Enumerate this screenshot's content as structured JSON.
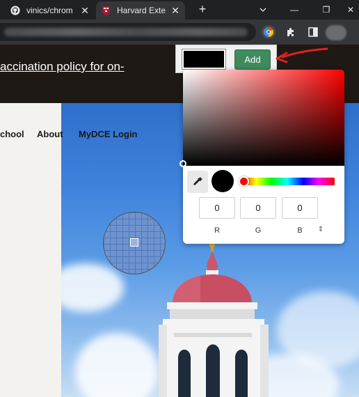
{
  "browser": {
    "tabs": [
      {
        "title": "vinics/chrom",
        "icon": "github-icon"
      },
      {
        "title": "Harvard Exte",
        "icon": "harvard-shield-icon"
      }
    ],
    "new_tab_label": "+",
    "window_controls": {
      "minimize": "—",
      "restore": "❐",
      "close": "✕"
    },
    "toolbar_icons": [
      "color-picker-extension-icon",
      "extensions-puzzle-icon",
      "side-panel-icon",
      "profile-avatar"
    ]
  },
  "page": {
    "announcement": "accination policy for on-",
    "nav": [
      {
        "label": "chool"
      },
      {
        "label": "About"
      },
      {
        "label": "MyDCE Login"
      }
    ]
  },
  "extension": {
    "swatch_color": "#000000",
    "add_label": "Add",
    "picker": {
      "hue_color": "#ff0000",
      "r": "0",
      "g": "0",
      "b": "0",
      "labels": {
        "r": "R",
        "g": "G",
        "b": "B"
      },
      "mode_toggle": "⇕"
    }
  },
  "colors": {
    "header_bg": "#1e1915",
    "add_button": "#3f8a5e",
    "annotation_arrow": "#e02020"
  }
}
